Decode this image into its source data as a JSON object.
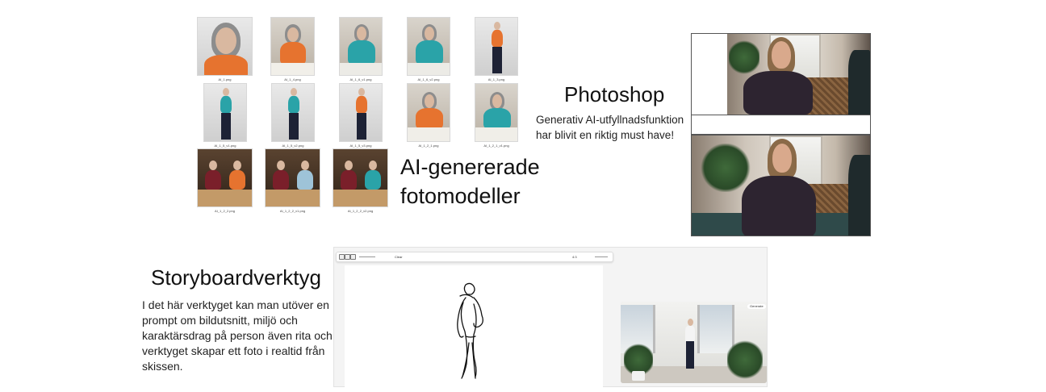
{
  "grid": {
    "captions": [
      "AI_1.png",
      "AI_1_4.png",
      "AI_1_6_v1.png",
      "AI_1_6_v2.png",
      "AI_1_3.png",
      "AI_1_5_v1.png",
      "AI_1_5_v2.png",
      "AI_1_5_v3.png",
      "AI_1_2_1.png",
      "AI_1_2_1_v1.png",
      "AI_1_2_2.png",
      "AI_1_2_2_v1.png",
      "AI_1_2_2_v2.png"
    ],
    "title_line1": "AI-genererade",
    "title_line2": "fotomodeller"
  },
  "photoshop": {
    "title": "Photoshop",
    "desc_line1": "Generativ AI-utfyllnadsfunktion",
    "desc_line2": "har blivit en riktig must have!"
  },
  "storyboard": {
    "title": "Storyboardverktyg",
    "desc_lines": [
      "I det här verktyget kan man utöver en",
      "prompt om bildutsnitt, miljö och",
      "karaktärsdrag på person även rita och",
      "verktyget skapar ett foto i realtid från",
      "skissen."
    ],
    "toolbar_text": "Clear",
    "toolbar_right": "4:3",
    "badge": "Generate"
  },
  "colors": {
    "orange_top": "#e6732f",
    "teal_top": "#2aa3a8",
    "pants": "#1d2235"
  }
}
